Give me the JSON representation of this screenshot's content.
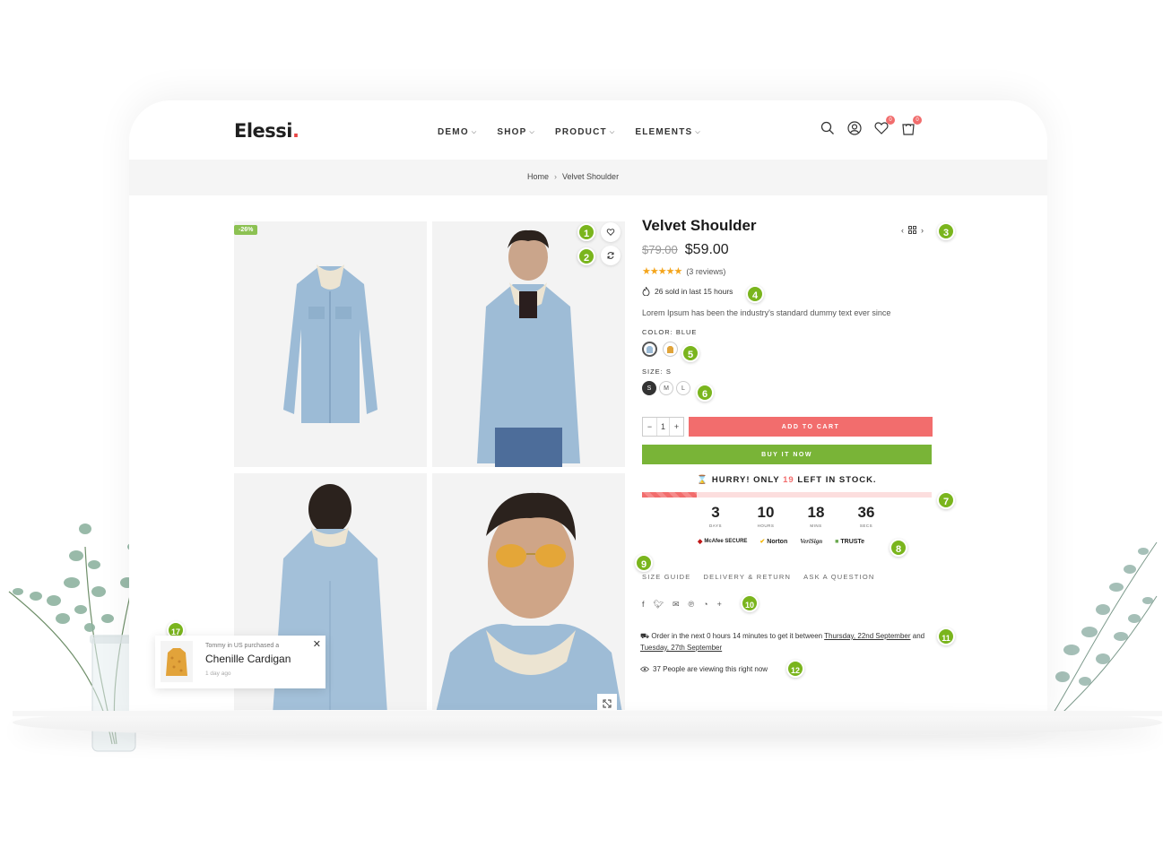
{
  "brand": {
    "name": "Elessi",
    "dot": "."
  },
  "nav": [
    {
      "label": "DEMO"
    },
    {
      "label": "SHOP"
    },
    {
      "label": "PRODUCT"
    },
    {
      "label": "ELEMENTS"
    }
  ],
  "header_icons": {
    "wishlist_count": "0",
    "cart_count": "0"
  },
  "breadcrumb": {
    "home": "Home",
    "separator": "›",
    "current": "Velvet Shoulder"
  },
  "gallery": {
    "sale_badge": "-26%"
  },
  "product": {
    "title": "Velvet Shoulder",
    "old_price": "$79.00",
    "price": "$59.00",
    "stars": "★★★★★",
    "reviews": "(3 reviews)",
    "sold": "26 sold in last 15 hours",
    "description": "Lorem Ipsum has been the industry's standard dummy text ever since",
    "color_label": "COLOR: BLUE",
    "size_label": "SIZE: S",
    "sizes": [
      "S",
      "M",
      "L"
    ],
    "quantity": "1",
    "qty_minus": "−",
    "qty_plus": "+",
    "add_to_cart": "ADD TO CART",
    "buy_now": "BUY IT NOW"
  },
  "stock": {
    "hurry_prefix": "HURRY! ONLY",
    "left": "19",
    "hurry_suffix": "LEFT IN STOCK.",
    "level": 0.19
  },
  "countdown": [
    {
      "value": "3",
      "unit": "DAYS"
    },
    {
      "value": "10",
      "unit": "HOURS"
    },
    {
      "value": "18",
      "unit": "MINS"
    },
    {
      "value": "36",
      "unit": "SECS"
    }
  ],
  "trust_badges": [
    "McAfee SECURE",
    "Norton",
    "VeriSign",
    "TRUSTe"
  ],
  "info_tabs": [
    "SIZE GUIDE",
    "DELIVERY & RETURN",
    "ASK A QUESTION"
  ],
  "share_icons": [
    "facebook-icon",
    "twitter-icon",
    "email-icon",
    "pinterest-icon",
    "messenger-icon",
    "plus-icon"
  ],
  "delivery": {
    "text1": "Order in the next 0 hours 14 minutes to get it between",
    "date1": "Thursday, 22nd September",
    "and": "and",
    "date2": "Tuesday, 27th September"
  },
  "viewing": "37 People are viewing this right now",
  "popup": {
    "who": "Tommy in US purchased a",
    "product": "Chenille Cardigan",
    "ago": "1 day ago",
    "close": "✕"
  },
  "markers": [
    "1",
    "2",
    "3",
    "4",
    "5",
    "6",
    "7",
    "8",
    "9",
    "10",
    "11",
    "12",
    "17"
  ],
  "colors": {
    "accent_green": "#79b437",
    "accent_red": "#f26d6d",
    "star": "#f4a51c"
  }
}
